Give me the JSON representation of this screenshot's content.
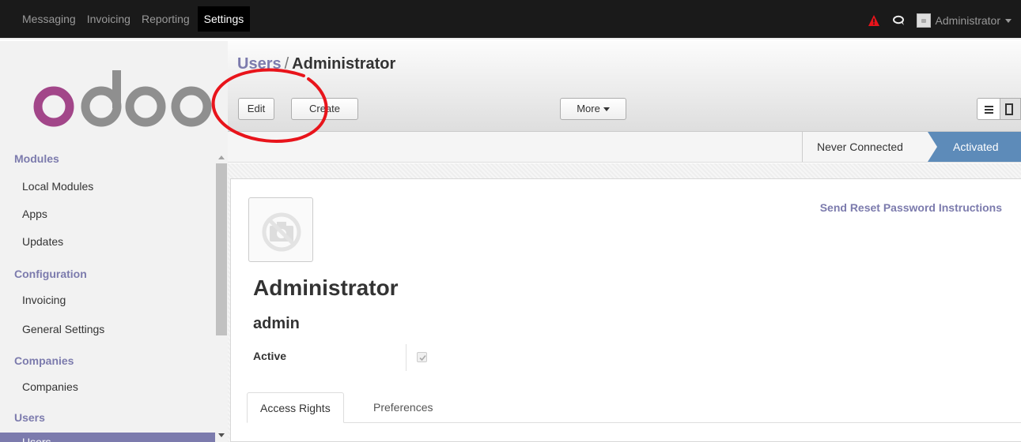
{
  "topbar": {
    "menu": [
      "Messaging",
      "Invoicing",
      "Reporting"
    ],
    "active_app": "Settings",
    "user": "Administrator"
  },
  "sidebar": {
    "logo_text": "odoo",
    "sections": [
      {
        "title": "Modules",
        "items": [
          "Local Modules",
          "Apps",
          "Updates"
        ]
      },
      {
        "title": "Configuration",
        "items": [
          "Invoicing",
          "General Settings"
        ]
      },
      {
        "title": "Companies",
        "items": [
          "Companies"
        ]
      },
      {
        "title": "Users",
        "items": [
          "Users"
        ]
      }
    ]
  },
  "breadcrumb": {
    "parent": "Users",
    "separator": "/",
    "current": "Administrator"
  },
  "buttons": {
    "edit": "Edit",
    "create": "Create",
    "more": "More"
  },
  "status": {
    "never": "Never Connected",
    "activated": "Activated"
  },
  "form": {
    "reset_link": "Send Reset Password Instructions",
    "name": "Administrator",
    "login": "admin",
    "active_label": "Active",
    "active": true
  },
  "tabs": [
    "Access Rights",
    "Preferences"
  ],
  "colors": {
    "accent": "#7c7bad",
    "status_active": "#5d8bb9",
    "annotation": "#e8141b",
    "warning": "#e8141b"
  }
}
